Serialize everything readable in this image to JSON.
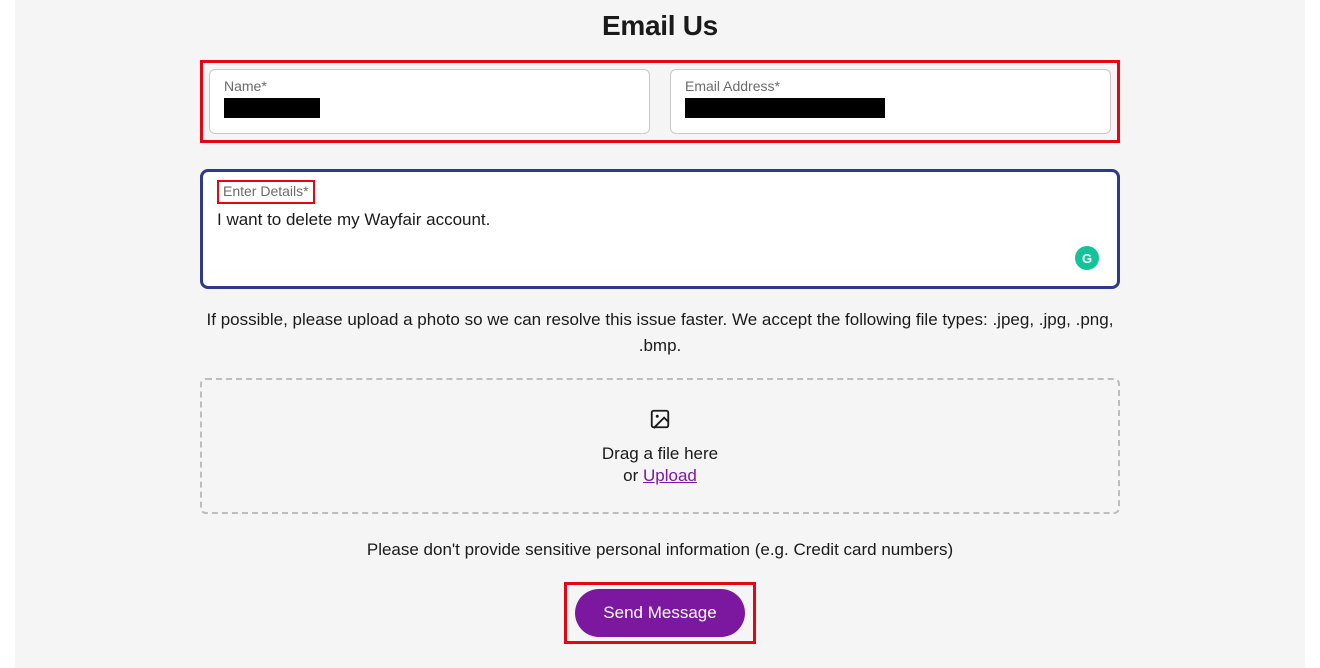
{
  "title": "Email Us",
  "fields": {
    "name": {
      "label": "Name*"
    },
    "email": {
      "label": "Email Address*"
    },
    "details": {
      "label": "Enter Details*",
      "value": "I want to delete my Wayfair account."
    }
  },
  "upload_helper": "If possible, please upload a photo so we can resolve this issue faster. We accept the following file types: .jpeg, .jpg, .png, .bmp.",
  "dropzone": {
    "drag_line": "Drag a file here",
    "or_prefix": "or ",
    "upload_label": "Upload"
  },
  "sensitive_warning": "Please don't provide sensitive personal information (e.g. Credit card numbers)",
  "submit_label": "Send Message",
  "grammarly_badge": "G"
}
